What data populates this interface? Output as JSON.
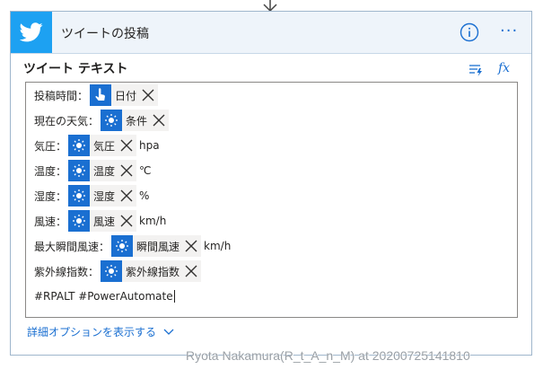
{
  "action": {
    "title": "ツイートの投稿"
  },
  "field": {
    "label": "ツイート テキスト"
  },
  "lines": [
    {
      "prefix": "投稿時間：",
      "token": {
        "label": "日付",
        "icon": "hand-pointer-icon"
      },
      "suffix": ""
    },
    {
      "prefix": "現在の天気：",
      "token": {
        "label": "条件",
        "icon": "sun-icon"
      },
      "suffix": ""
    },
    {
      "prefix": "気圧：",
      "token": {
        "label": "気圧",
        "icon": "sun-icon"
      },
      "suffix": "hpa"
    },
    {
      "prefix": "温度：",
      "token": {
        "label": "温度",
        "icon": "sun-icon"
      },
      "suffix": "℃"
    },
    {
      "prefix": "湿度：",
      "token": {
        "label": "湿度",
        "icon": "sun-icon"
      },
      "suffix": "%"
    },
    {
      "prefix": "風速：",
      "token": {
        "label": "風速",
        "icon": "sun-icon"
      },
      "suffix": "km/h"
    },
    {
      "prefix": "最大瞬間風速：",
      "token": {
        "label": "瞬間風速",
        "icon": "sun-icon"
      },
      "suffix": "km/h"
    },
    {
      "prefix": "紫外線指数：",
      "token": {
        "label": "紫外線指数",
        "icon": "sun-icon"
      },
      "suffix": ""
    }
  ],
  "hashtags": "#RPALT #PowerAutomate",
  "advanced_options": "詳細オプションを表示する",
  "watermark": "Ryota Nakamura(R_t_A_n_M) at 20200725141810",
  "colors": {
    "accent": "#1a6fd1",
    "twitter": "#1da1f2",
    "header_bg": "#eef4fa",
    "token_bg": "#f3f2f1"
  }
}
